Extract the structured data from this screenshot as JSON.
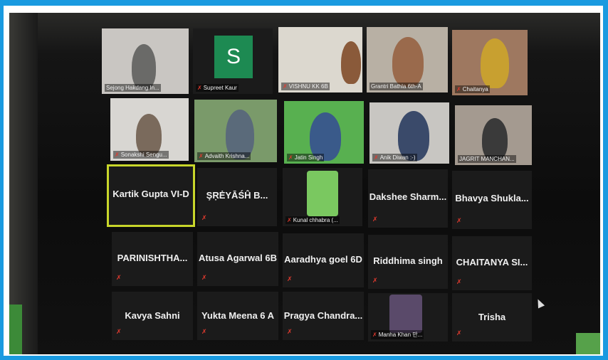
{
  "tiles": [
    {
      "name": "Sejong Hakdang In..."
    },
    {
      "name": "Supreet Kaur",
      "avatar_letter": "S"
    },
    {
      "name": "VISHNU KK 6B"
    },
    {
      "name": "Grantri Bathla 6th-A"
    },
    {
      "name": "Chaitanya"
    },
    {
      "name": "Sonakshi Sengu..."
    },
    {
      "name": "Advaith Krishna..."
    },
    {
      "name": "Jatin Singh"
    },
    {
      "name": "Anik Diwan :-)"
    },
    {
      "name": "JAGRIT MANCHAN..."
    },
    {
      "name": "Kartik Gupta VI-D"
    },
    {
      "name": "ŞṚĖYĀŚĤ B..."
    },
    {
      "name": "Kunal chhabra (..."
    },
    {
      "name": "Dakshee Sharm..."
    },
    {
      "name": "Bhavya Shukla..."
    },
    {
      "name": "PARINISHTHA..."
    },
    {
      "name": "Atusa Agarwal 6B"
    },
    {
      "name": "Aaradhya goel 6D"
    },
    {
      "name": "Riddhima singh"
    },
    {
      "name": "CHAITANYA SI..."
    },
    {
      "name": "Kavya Sahni"
    },
    {
      "name": "Yukta Meena 6 A"
    },
    {
      "name": "Pragya Chandra..."
    },
    {
      "name": "Manha Khan 만..."
    },
    {
      "name": "Trisha"
    }
  ],
  "colors": {
    "active_speaker": "#c8d62a",
    "muted_mic": "#e03a2e",
    "avatar_bg": "#1d8a52"
  }
}
